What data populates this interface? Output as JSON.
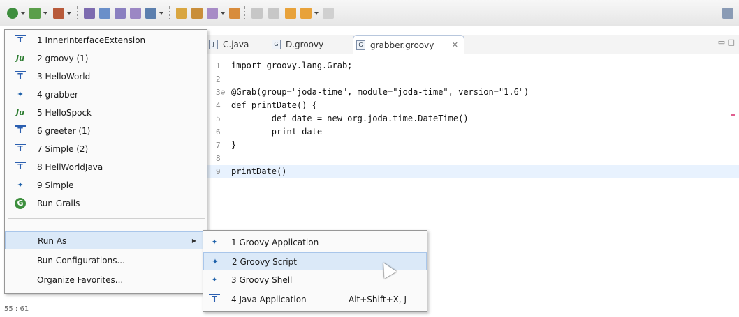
{
  "colors": {
    "toolbar_bg": "#eaeaea",
    "menu_highlight": "#dbe9f8",
    "current_line": "#e8f2fe",
    "keyword": "#7f0055"
  },
  "toolbar": {
    "icons": [
      "run-icon",
      "debug-icon",
      "coverage-icon",
      "new-project-icon",
      "new-package-icon",
      "new-class-icon",
      "new-file-icon",
      "open-type-icon",
      "search-icon",
      "annotation-icon",
      "edit-icon",
      "next-annotation-icon",
      "prev-annotation-icon",
      "back-icon",
      "forward-icon"
    ]
  },
  "editor": {
    "tabs": [
      {
        "label": "C.java",
        "icon": "java-file-icon"
      },
      {
        "label": "D.groovy",
        "icon": "groovy-file-icon"
      },
      {
        "label": "grabber.groovy",
        "icon": "groovy-file-icon",
        "close": "✕"
      }
    ],
    "lines": [
      {
        "num": "1",
        "text": "import groovy.lang.Grab;"
      },
      {
        "num": "2",
        "text": ""
      },
      {
        "num": "3⊖",
        "text": "@Grab(group=\"joda-time\", module=\"joda-time\", version=\"1.6\")"
      },
      {
        "num": "4",
        "text": "def printDate() {"
      },
      {
        "num": "5",
        "text": "        def date = new org.joda.time.DateTime()"
      },
      {
        "num": "6",
        "text": "        print date"
      },
      {
        "num": "7",
        "text": "}"
      },
      {
        "num": "8",
        "text": ""
      },
      {
        "num": "9",
        "text": "printDate()"
      }
    ],
    "status": "55 : 61"
  },
  "menu": {
    "items": [
      {
        "label": "1 InnerInterfaceExtension",
        "icon": "junit-icon"
      },
      {
        "label": "2 groovy (1)",
        "icon": "junit-icon"
      },
      {
        "label": "3 HelloWorld",
        "icon": "junit-icon"
      },
      {
        "label": "4 grabber",
        "icon": "groovy-icon"
      },
      {
        "label": "5 HelloSpock",
        "icon": "junit-icon"
      },
      {
        "label": "6 greeter (1)",
        "icon": "junit-icon"
      },
      {
        "label": "7 Simple (2)",
        "icon": "junit-icon"
      },
      {
        "label": "8 HellWorldJava",
        "icon": "junit-icon"
      },
      {
        "label": "9 Simple",
        "icon": "groovy-icon"
      },
      {
        "label": "Run Grails",
        "icon": "grails-icon"
      },
      {
        "label": "Run As",
        "arrow": "▶"
      },
      {
        "label": "Run Configurations..."
      },
      {
        "label": "Organize Favorites..."
      }
    ]
  },
  "submenu": {
    "items": [
      {
        "label": "1 Groovy Application",
        "icon": "groovy-icon"
      },
      {
        "label": "2 Groovy Script",
        "icon": "groovy-icon"
      },
      {
        "label": "3 Groovy Shell",
        "icon": "groovy-icon"
      },
      {
        "label": "4 Java Application",
        "icon": "java-app-icon",
        "accel": "Alt+Shift+X, J"
      }
    ]
  }
}
